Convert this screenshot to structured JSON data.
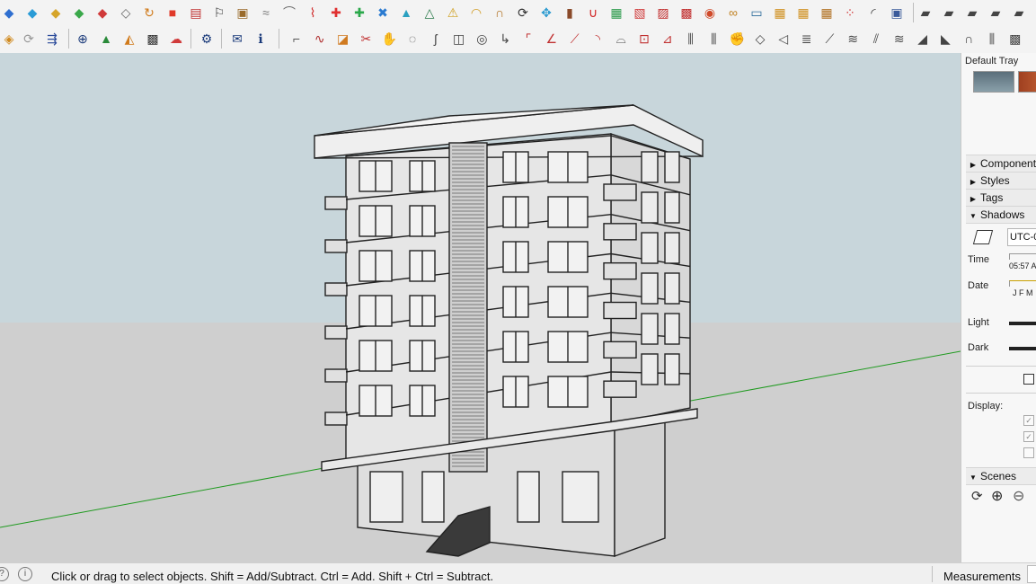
{
  "toolbar": {
    "row1_icons": [
      {
        "name": "new-icon",
        "glyph": "◆",
        "color": "#2f6fd0"
      },
      {
        "name": "open-icon",
        "glyph": "◆",
        "color": "#2a9bd6"
      },
      {
        "name": "save-icon",
        "glyph": "◆",
        "color": "#d6a52a"
      },
      {
        "name": "cut-icon",
        "glyph": "◆",
        "color": "#3aa84a"
      },
      {
        "name": "copy-icon",
        "glyph": "◆",
        "color": "#d03a3a"
      },
      {
        "name": "paste-icon",
        "glyph": "◇",
        "color": "#666666"
      },
      {
        "name": "orbit-icon",
        "glyph": "↻",
        "color": "#d07a1a"
      },
      {
        "name": "rectangle-icon",
        "glyph": "■",
        "color": "#e03a2a"
      },
      {
        "name": "table-icon",
        "glyph": "▤",
        "color": "#c03030"
      },
      {
        "name": "flag-icon",
        "glyph": "⚐",
        "color": "#333333"
      },
      {
        "name": "box-icon",
        "glyph": "▣",
        "color": "#9a6a2a"
      },
      {
        "name": "pipe-icon",
        "glyph": "≈",
        "color": "#777777"
      },
      {
        "name": "curve-icon",
        "glyph": "⌒",
        "color": "#666666"
      },
      {
        "name": "dots-curve-icon",
        "glyph": "⌇",
        "color": "#d02a2a"
      },
      {
        "name": "plus-red-icon",
        "glyph": "✚",
        "color": "#e03030"
      },
      {
        "name": "plus-green-icon",
        "glyph": "✚",
        "color": "#2aa84a"
      },
      {
        "name": "cross-blue-icon",
        "glyph": "✖",
        "color": "#2a7ad0"
      },
      {
        "name": "cone-icon",
        "glyph": "▲",
        "color": "#2aa0c0"
      },
      {
        "name": "cone-outline-icon",
        "glyph": "△",
        "color": "#2a7a4a"
      },
      {
        "name": "warning-icon",
        "glyph": "⚠",
        "color": "#d0a020"
      },
      {
        "name": "arc-icon",
        "glyph": "◠",
        "color": "#d09a20"
      },
      {
        "name": "hook-icon",
        "glyph": "∩",
        "color": "#b07020"
      },
      {
        "name": "rotate-icon",
        "glyph": "⟳",
        "color": "#333333"
      },
      {
        "name": "move-icon",
        "glyph": "✥",
        "color": "#2a9ad0"
      },
      {
        "name": "cup-icon",
        "glyph": "▮",
        "color": "#8a4a2a"
      },
      {
        "name": "magnet-icon",
        "glyph": "∪",
        "color": "#d02020"
      },
      {
        "name": "stack-icon",
        "glyph": "▦",
        "color": "#2a9a4a"
      },
      {
        "name": "layers-icon",
        "glyph": "▧",
        "color": "#d03a3a"
      },
      {
        "name": "component-icon",
        "glyph": "▨",
        "color": "#c02a2a"
      },
      {
        "name": "group-icon",
        "glyph": "▩",
        "color": "#c02a2a"
      },
      {
        "name": "gem-icon",
        "glyph": "◉",
        "color": "#d04a2a"
      },
      {
        "name": "chain-icon",
        "glyph": "∞",
        "color": "#c08020"
      },
      {
        "name": "frame-icon",
        "glyph": "▭",
        "color": "#2a6a9a"
      },
      {
        "name": "grid-icon",
        "glyph": "▦",
        "color": "#d09020"
      },
      {
        "name": "grid-alt-icon",
        "glyph": "▦",
        "color": "#d09020"
      },
      {
        "name": "grid-dark-icon",
        "glyph": "▦",
        "color": "#b07020"
      },
      {
        "name": "scatter-icon",
        "glyph": "⁘",
        "color": "#d03030"
      },
      {
        "name": "dotted-arc-icon",
        "glyph": "◜",
        "color": "#333333"
      },
      {
        "name": "panels-icon",
        "glyph": "▣",
        "color": "#3a5a9a"
      },
      {
        "name": "view-iso-icon",
        "glyph": "▰",
        "color": "#444444"
      },
      {
        "name": "view-top-icon",
        "glyph": "▰",
        "color": "#444444"
      },
      {
        "name": "view-front-icon",
        "glyph": "▰",
        "color": "#444444"
      },
      {
        "name": "view-right-icon",
        "glyph": "▰",
        "color": "#444444"
      },
      {
        "name": "view-back-icon",
        "glyph": "▰",
        "color": "#444444"
      }
    ],
    "row2_left_icons": [
      {
        "name": "select-arrow-icon",
        "glyph": "◈",
        "color": "#d08a20"
      },
      {
        "name": "refresh-icon",
        "glyph": "⟳",
        "color": "#999999"
      },
      {
        "name": "export-icon",
        "glyph": "⇶",
        "color": "#2a4a9a"
      },
      {
        "name": "add-circle-icon",
        "glyph": "⊕",
        "color": "#1a3a7a"
      },
      {
        "name": "tree-icon",
        "glyph": "▲",
        "color": "#2a8a3a"
      },
      {
        "name": "terrain-icon",
        "glyph": "◭",
        "color": "#d07a1a"
      },
      {
        "name": "checker-icon",
        "glyph": "▩",
        "color": "#333333"
      },
      {
        "name": "cloud-upload-icon",
        "glyph": "☁",
        "color": "#d03a3a"
      },
      {
        "name": "settings-icon",
        "glyph": "⚙",
        "color": "#1a3a7a"
      },
      {
        "name": "mail-icon",
        "glyph": "✉",
        "color": "#1a3a7a"
      },
      {
        "name": "info-icon",
        "glyph": "ℹ",
        "color": "#1a3a7a"
      }
    ],
    "row2_right_icons": [
      {
        "name": "line-tool-icon",
        "glyph": "⌐",
        "color": "#555555"
      },
      {
        "name": "freehand-tool-icon",
        "glyph": "∿",
        "color": "#b03030"
      },
      {
        "name": "eraser-tool-icon",
        "glyph": "◪",
        "color": "#d07a20"
      },
      {
        "name": "scissors-tool-icon",
        "glyph": "✂",
        "color": "#c03030"
      },
      {
        "name": "hand-tool-icon",
        "glyph": "✋",
        "color": "#444444"
      },
      {
        "name": "bubble-tool-icon",
        "glyph": "◌",
        "color": "#444444"
      },
      {
        "name": "curl-tool-icon",
        "glyph": "ʃ",
        "color": "#444444"
      },
      {
        "name": "cube-tool-icon",
        "glyph": "◫",
        "color": "#444444"
      },
      {
        "name": "face-tool-icon",
        "glyph": "◎",
        "color": "#444444"
      },
      {
        "name": "hook-tool-icon",
        "glyph": "↳",
        "color": "#444444"
      },
      {
        "name": "corner-tool-icon",
        "glyph": "⌜",
        "color": "#c03030"
      },
      {
        "name": "angle-tool-icon",
        "glyph": "∠",
        "color": "#c03030"
      },
      {
        "name": "slope-tool-icon",
        "glyph": "⟋",
        "color": "#c03030"
      },
      {
        "name": "arc-tool-icon",
        "glyph": "◝",
        "color": "#c03030"
      },
      {
        "name": "bridge-tool-icon",
        "glyph": "⌓",
        "color": "#444444"
      },
      {
        "name": "tape-tool-icon",
        "glyph": "⊡",
        "color": "#c03030"
      },
      {
        "name": "protractor-tool-icon",
        "glyph": "⊿",
        "color": "#c03030"
      },
      {
        "name": "columns-tool-icon",
        "glyph": "⫼",
        "color": "#444444"
      },
      {
        "name": "colonnade-tool-icon",
        "glyph": "⫼",
        "color": "#444444"
      },
      {
        "name": "glove-tool-icon",
        "glyph": "✊",
        "color": "#444444"
      },
      {
        "name": "panel-tool-icon",
        "glyph": "◇",
        "color": "#444444"
      },
      {
        "name": "fan-tool-icon",
        "glyph": "◁",
        "color": "#444444"
      },
      {
        "name": "stairs-tool-icon",
        "glyph": "≣",
        "color": "#444444"
      },
      {
        "name": "ramp-tool-icon",
        "glyph": "⟋",
        "color": "#444444"
      },
      {
        "name": "lines-tool-icon",
        "glyph": "≋",
        "color": "#444444"
      },
      {
        "name": "skew-tool-icon",
        "glyph": "⫽",
        "color": "#444444"
      },
      {
        "name": "lines-alt-tool-icon",
        "glyph": "≋",
        "color": "#444444"
      },
      {
        "name": "shape-tool-icon",
        "glyph": "◢",
        "color": "#444444"
      },
      {
        "name": "wedge-tool-icon",
        "glyph": "◣",
        "color": "#444444"
      },
      {
        "name": "arch-tool-icon",
        "glyph": "∩",
        "color": "#444444"
      },
      {
        "name": "grille-tool-icon",
        "glyph": "⫼",
        "color": "#444444"
      },
      {
        "name": "mesh-tool-icon",
        "glyph": "▩",
        "color": "#444444"
      }
    ]
  },
  "tray": {
    "title": "Default Tray",
    "panels": {
      "components": {
        "label": "Components",
        "expanded": false
      },
      "styles": {
        "label": "Styles",
        "expanded": false
      },
      "tags": {
        "label": "Tags",
        "expanded": false
      },
      "shadows": {
        "label": "Shadows",
        "expanded": true
      },
      "scenes": {
        "label": "Scenes",
        "expanded": true
      }
    },
    "shadows": {
      "timezone": "UTC-0",
      "time_label": "Time",
      "time_value": "05:57 A",
      "date_label": "Date",
      "months": "J F M",
      "light_label": "Light",
      "dark_label": "Dark",
      "display_label": "Display:"
    }
  },
  "status": {
    "message": "Click or drag to select objects. Shift = Add/Subtract. Ctrl = Add. Shift + Ctrl = Subtract.",
    "measurements_label": "Measurements"
  },
  "colors": {
    "sky": "#c8d6db",
    "ground": "#cfcfcf",
    "axis_green": "#1f9a1f"
  }
}
